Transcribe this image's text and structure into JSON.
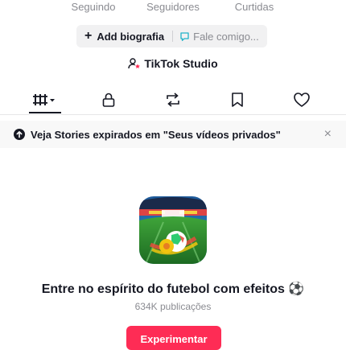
{
  "stats": {
    "following_label": "Seguindo",
    "followers_label": "Seguidores",
    "likes_label": "Curtidas"
  },
  "profile_actions": {
    "add_bio_label": "Add biografia",
    "message_placeholder": "Fale comigo..."
  },
  "studio": {
    "label": "TikTok Studio"
  },
  "tabs": [
    {
      "icon": "grid-videos-icon",
      "selected": true
    },
    {
      "icon": "lock-icon"
    },
    {
      "icon": "repost-icon"
    },
    {
      "icon": "bookmark-icon"
    },
    {
      "icon": "heart-icon"
    }
  ],
  "banner": {
    "text": "Veja Stories expirados em \"Seus vídeos privados\"",
    "close": "×"
  },
  "promo": {
    "title": "Entre no espírito do futebol com efeitos ⚽",
    "count": "634K publicações",
    "button_label": "Experimentar"
  },
  "colors": {
    "accent": "#fe2c55",
    "muted": "#8a8b91",
    "text": "#161823"
  }
}
